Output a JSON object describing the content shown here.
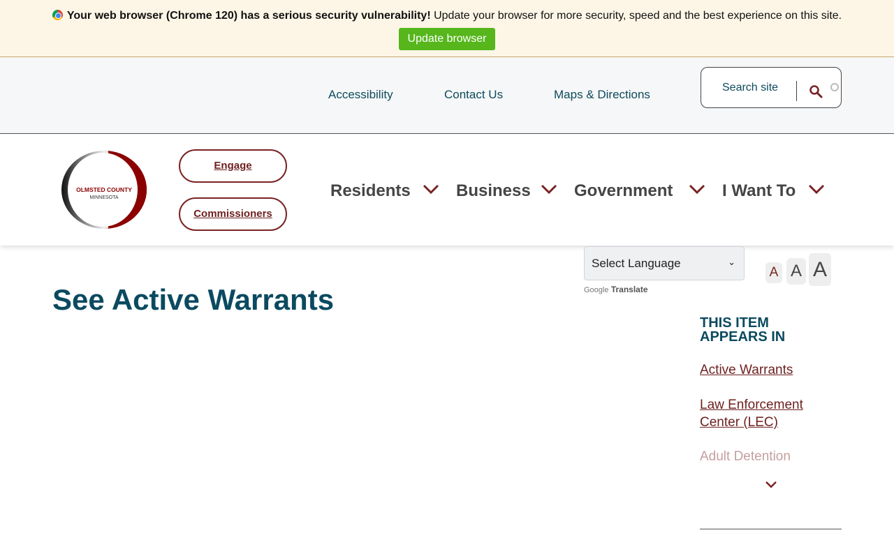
{
  "banner": {
    "warning_bold": "Your web browser (Chrome 120) has a serious security vulnerability!",
    "warning_text": " Update your browser for more security, speed and the best experience on this site.",
    "update_button": "Update browser"
  },
  "utility_nav": {
    "links": [
      "Accessibility",
      "Contact Us",
      "Maps & Directions"
    ],
    "search_label": "Search site"
  },
  "logo": {
    "line1": "OLMSTED COUNTY",
    "line2": "MINNESOTA"
  },
  "quick_buttons": [
    "Engage",
    "Commissioners"
  ],
  "main_nav": [
    "Residents",
    "Business",
    "Government",
    "I Want To"
  ],
  "translate": {
    "select_label": "Select Language",
    "powered_google": "Google",
    "powered_translate": "Translate"
  },
  "font_size_buttons": [
    "A",
    "A",
    "A"
  ],
  "page": {
    "title": "See Active Warrants"
  },
  "sidebar": {
    "heading_line1": "THIS ITEM",
    "heading_line2": "APPEARS IN",
    "links": [
      "Active Warrants",
      "Law Enforcement Center (LEC)",
      "Adult Detention"
    ]
  },
  "colors": {
    "accent_maroon": "#6d1f1f",
    "title_teal": "#0b4a60",
    "update_green": "#56b61c",
    "banner_bg": "#fdf6e7"
  }
}
